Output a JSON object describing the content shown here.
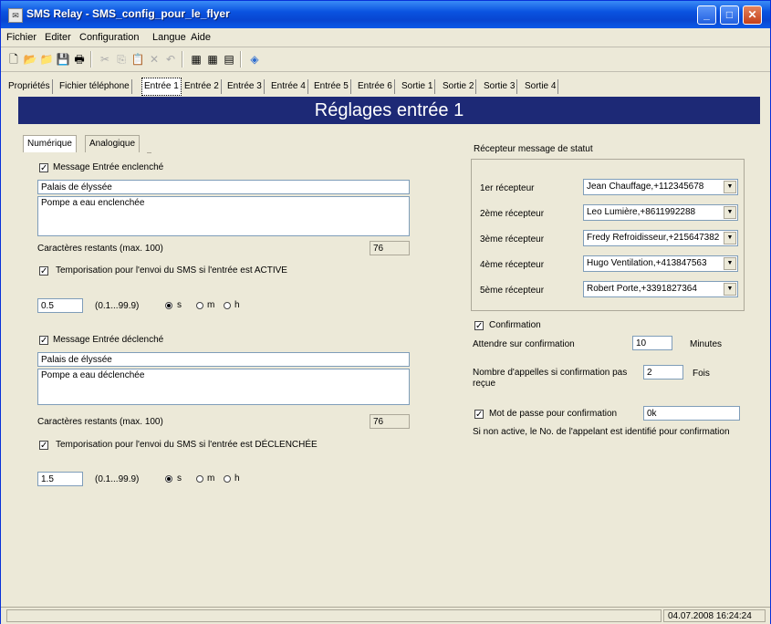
{
  "window": {
    "title": "SMS Relay - SMS_config_pour_le_flyer",
    "app_icon": "sms-relay-icon",
    "controls": [
      "minimize-icon",
      "maximize-icon",
      "close-icon"
    ]
  },
  "menu": [
    "Fichier",
    "Editer",
    "Configuration",
    "Langue",
    "Aide"
  ],
  "toolbar": {
    "icons": [
      "new-file-icon",
      "open-folder-icon",
      "open-icon",
      "save-icon",
      "print-icon",
      "cut-icon",
      "copy-icon",
      "paste-icon",
      "delete-icon",
      "undo-icon",
      "read-device-icon",
      "write-device-icon",
      "send-icon",
      "help-book-icon"
    ]
  },
  "tabs": [
    "Propriétés",
    "Fichier téléphone",
    "Entrée 1",
    "Entrée 2",
    "Entrée 3",
    "Entrée 4",
    "Entrée 5",
    "Entrée 6",
    "Sortie 1",
    "Sortie 2",
    "Sortie 3",
    "Sortie 4"
  ],
  "active_tab": "Entrée 1",
  "header": "Réglages entrée 1",
  "subtabs": [
    "Numérique",
    "Analogique"
  ],
  "left": {
    "on": {
      "checkbox_label": "Message Entrée enclenché",
      "checked": true,
      "line1": "Palais de élyssée",
      "line2": "Pompe a eau enclenchée",
      "remaining_label": "Caractères restants (max. 100)",
      "remaining_value": "76",
      "timer_checkbox_label": "Temporisation pour l'envoi du SMS si l'entrée est ACTIVE",
      "timer_checked": true,
      "timer_value": "0.5",
      "range": "(0.1...99.9)",
      "units": [
        "s",
        "m",
        "h"
      ],
      "selected_unit": "s"
    },
    "off": {
      "checkbox_label": "Message Entrée déclenché",
      "checked": true,
      "line1": "Palais de élyssée",
      "line2": "Pompe a eau déclenchée",
      "remaining_label": "Caractères restants (max. 100)",
      "remaining_value": "76",
      "timer_checkbox_label": "Temporisation pour l'envoi du SMS si l'entrée est DÉCLENCHÉE",
      "timer_checked": true,
      "timer_value": "1.5",
      "range": "(0.1...99.9)",
      "units": [
        "s",
        "m",
        "h"
      ],
      "selected_unit": "s"
    }
  },
  "right": {
    "receivers_title": "Récepteur message de statut",
    "receivers": [
      {
        "label": "1er récepteur",
        "value": "Jean Chauffage,+112345678"
      },
      {
        "label": "2ème récepteur",
        "value": "Leo Lumière,+8611992288"
      },
      {
        "label": "3ème récepteur",
        "value": "Fredy Refroidisseur,+215647382"
      },
      {
        "label": "4ème récepteur",
        "value": "Hugo Ventilation,+413847563"
      },
      {
        "label": "5ème récepteur",
        "value": "Robert Porte,+3391827364"
      }
    ],
    "confirmation_label": "Confirmation",
    "confirmation_checked": true,
    "wait_label": "Attendre sur confirmation",
    "wait_value": "10",
    "wait_unit": "Minutes",
    "calls_label_1": "Nombre d'appelles si confirmation pas",
    "calls_label_2": "reçue",
    "calls_value": "2",
    "calls_unit": "Fois",
    "password_label": "Mot de passe pour confirmation",
    "password_checked": true,
    "password_value": "0k",
    "note": "Si non active, le No. de l'appelant est identifié pour confirmation"
  },
  "status": {
    "datetime": "04.07.2008 16:24:24"
  }
}
